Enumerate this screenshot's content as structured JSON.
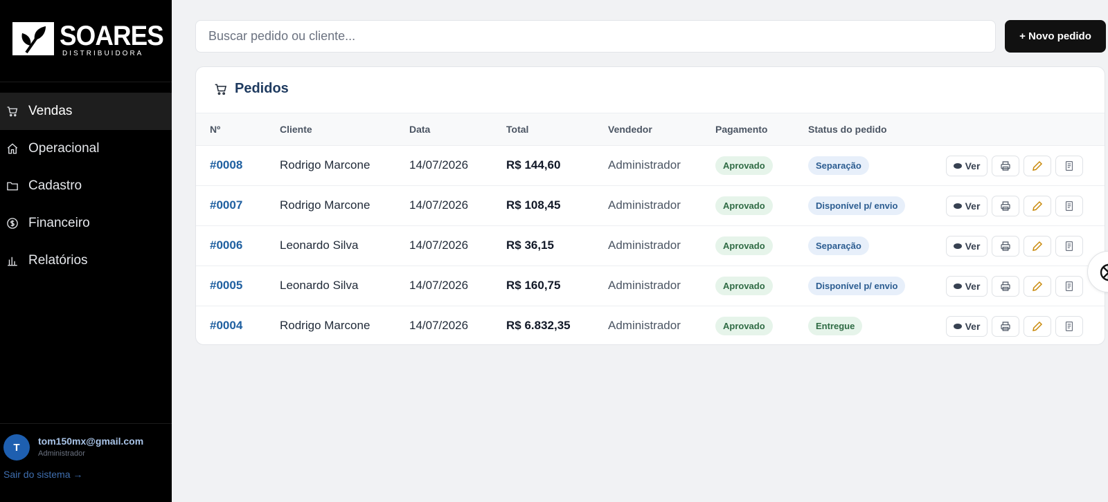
{
  "brand": {
    "name": "SOARES",
    "subtitle": "DISTRIBUIDORA"
  },
  "sidebar": {
    "items": [
      {
        "label": "Vendas",
        "icon": "cart-icon",
        "active": true
      },
      {
        "label": "Operacional",
        "icon": "home-icon",
        "active": false
      },
      {
        "label": "Cadastro",
        "icon": "folder-icon",
        "active": false
      },
      {
        "label": "Financeiro",
        "icon": "dollar-circle-icon",
        "active": false
      },
      {
        "label": "Relatórios",
        "icon": "bar-chart-icon",
        "active": false
      }
    ]
  },
  "user": {
    "initial": "T",
    "email": "tom150mx@gmail.com",
    "role": "Administrador",
    "logout": "Sair do sistema →"
  },
  "search": {
    "placeholder": "Buscar pedido ou cliente...",
    "value": ""
  },
  "toolbar": {
    "new_order_label": "+ Novo pedido"
  },
  "orders": {
    "title": "Pedidos",
    "columns": [
      "Nº",
      "Cliente",
      "Data",
      "Total",
      "Vendedor",
      "Pagamento",
      "Status do pedido"
    ],
    "view_label": "Ver",
    "rows": [
      {
        "num": "#0008",
        "client": "Rodrigo Marcone",
        "date": "14/07/2026",
        "total": "R$ 144,60",
        "seller": "Administrador",
        "payment": "Aprovado",
        "status": "Separação"
      },
      {
        "num": "#0007",
        "client": "Rodrigo Marcone",
        "date": "14/07/2026",
        "total": "R$ 108,45",
        "seller": "Administrador",
        "payment": "Aprovado",
        "status": "Disponível p/ envio"
      },
      {
        "num": "#0006",
        "client": "Leonardo Silva",
        "date": "14/07/2026",
        "total": "R$ 36,15",
        "seller": "Administrador",
        "payment": "Aprovado",
        "status": "Separação"
      },
      {
        "num": "#0005",
        "client": "Leonardo Silva",
        "date": "14/07/2026",
        "total": "R$ 160,75",
        "seller": "Administrador",
        "payment": "Aprovado",
        "status": "Disponível p/ envio"
      },
      {
        "num": "#0004",
        "client": "Rodrigo Marcone",
        "date": "14/07/2026",
        "total": "R$ 6.832,35",
        "seller": "Administrador",
        "payment": "Aprovado",
        "status": "Entregue"
      }
    ]
  },
  "colors": {
    "sidebar_bg": "#000000",
    "accent_blue": "#1e5fa0",
    "pay_badge": "#e6f4ea",
    "status_badge": "#e7effa",
    "edit_icon": "#c98a0c"
  }
}
